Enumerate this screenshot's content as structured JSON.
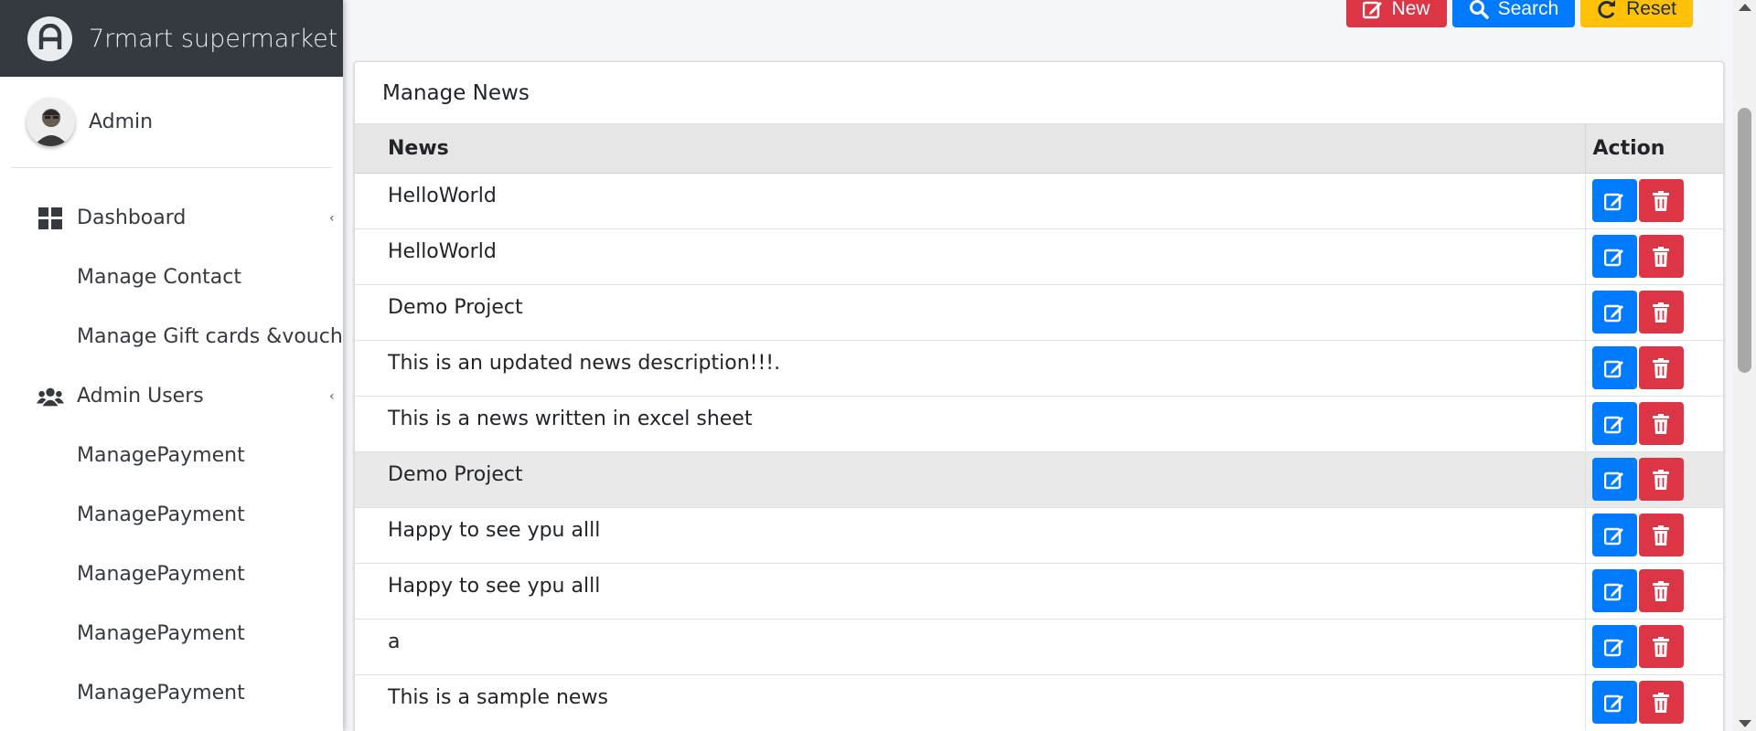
{
  "brand": {
    "title": "7rmart supermarket"
  },
  "user": {
    "name": "Admin"
  },
  "sidebar": {
    "items": [
      {
        "label": "Dashboard",
        "icon": "dashboard-icon",
        "has_caret": true
      },
      {
        "label": "Manage Contact"
      },
      {
        "label": "Manage Gift cards &voucher"
      },
      {
        "label": "Admin Users",
        "icon": "users-icon",
        "has_caret": true
      },
      {
        "label": "ManagePayment"
      },
      {
        "label": "ManagePayment"
      },
      {
        "label": "ManagePayment"
      },
      {
        "label": "ManagePayment"
      },
      {
        "label": "ManagePayment"
      }
    ]
  },
  "toolbar": {
    "new_label": "New",
    "search_label": "Search",
    "reset_label": "Reset"
  },
  "card": {
    "title": "Manage News"
  },
  "table": {
    "headers": {
      "news": "News",
      "action": "Action"
    },
    "rows": [
      {
        "news": "HelloWorld"
      },
      {
        "news": "HelloWorld"
      },
      {
        "news": "Demo Project"
      },
      {
        "news": "This is an updated news description!!!."
      },
      {
        "news": "This is a news written in excel sheet"
      },
      {
        "news": "Demo Project",
        "hovered": true
      },
      {
        "news": "Happy to see ypu alll"
      },
      {
        "news": "Happy to see ypu alll"
      },
      {
        "news": "a"
      },
      {
        "news": "This is a sample news"
      }
    ]
  },
  "colors": {
    "primary": "#007bff",
    "danger": "#dc3545",
    "warning": "#ffc107",
    "brand_bg": "#343a40"
  }
}
